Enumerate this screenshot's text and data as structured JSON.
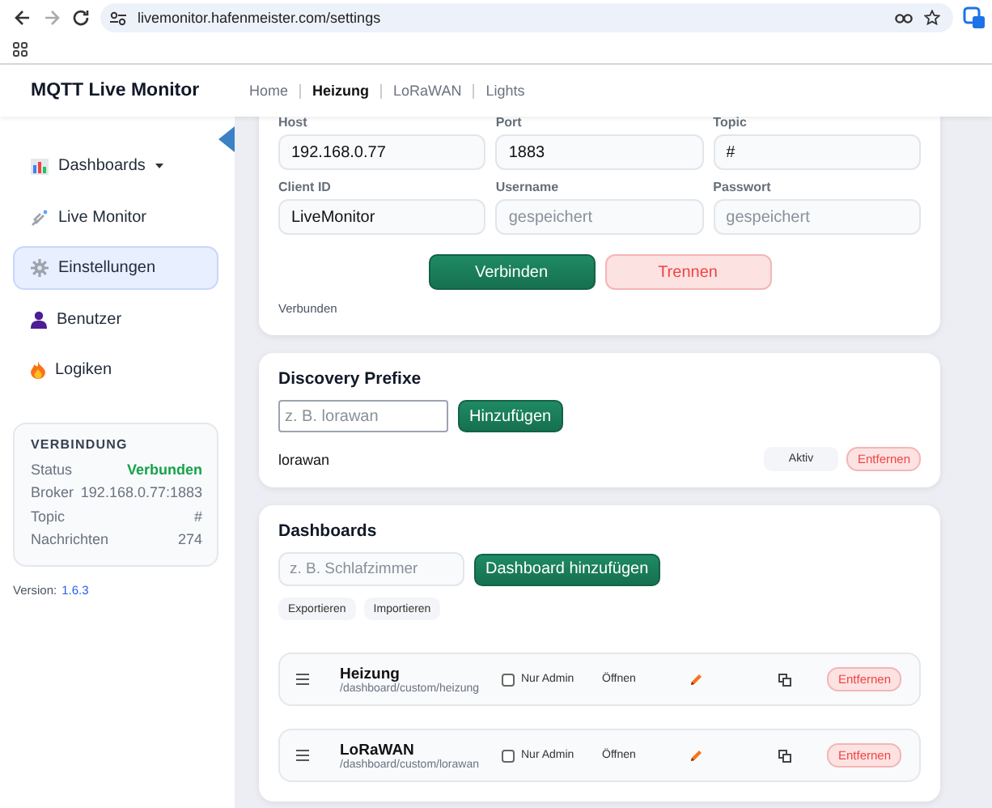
{
  "browser": {
    "url": "livemonitor.hafenmeister.com/settings"
  },
  "header": {
    "title": "MQTT Live Monitor",
    "nav": [
      {
        "label": "Home",
        "selected": false
      },
      {
        "label": "Heizung",
        "selected": true
      },
      {
        "label": "LoRaWAN",
        "selected": false
      },
      {
        "label": "Lights",
        "selected": false
      }
    ]
  },
  "sidebar": {
    "items": [
      {
        "label": "Dashboards",
        "dropdown": true,
        "selected": false
      },
      {
        "label": "Live Monitor",
        "dropdown": false,
        "selected": false
      },
      {
        "label": "Einstellungen",
        "dropdown": false,
        "selected": true
      },
      {
        "label": "Benutzer",
        "dropdown": false,
        "selected": false
      },
      {
        "label": "Logiken",
        "dropdown": false,
        "selected": false
      }
    ],
    "connection": {
      "title": "VERBINDUNG",
      "rows": [
        {
          "label": "Status",
          "value": "Verbunden",
          "kind": "status"
        },
        {
          "label": "Broker",
          "value": "192.168.0.77:1883",
          "kind": "plain"
        },
        {
          "label": "Topic",
          "value": "#",
          "kind": "plain"
        },
        {
          "label": "Nachrichten",
          "value": "274",
          "kind": "plain"
        }
      ]
    },
    "version_label": "Version:",
    "version": "1.6.3"
  },
  "mqtt": {
    "fields": [
      {
        "label": "Host",
        "value": "192.168.0.77"
      },
      {
        "label": "Port",
        "value": "1883"
      },
      {
        "label": "Topic",
        "value": "#"
      },
      {
        "label": "Client ID",
        "value": "LiveMonitor"
      },
      {
        "label": "Username",
        "placeholder": "gespeichert"
      },
      {
        "label": "Passwort",
        "placeholder": "gespeichert"
      }
    ],
    "connect_button": "Verbinden",
    "disconnect_button": "Trennen",
    "status": "Verbunden"
  },
  "discovery": {
    "title": "Discovery Prefixe",
    "input": {
      "placeholder": "z. B. lorawan"
    },
    "add_button": "Hinzufügen",
    "prefixes": [
      {
        "name": "lorawan",
        "status": "Aktiv",
        "remove_button": "Entfernen"
      }
    ]
  },
  "dashboards": {
    "title": "Dashboards",
    "input": {
      "placeholder": "z. B. Schlafzimmer"
    },
    "add_button": "Dashboard hinzufügen",
    "export_button": "Exportieren",
    "import_button": "Importieren",
    "rows": [
      {
        "name": "Heizung",
        "path": "/dashboard/custom/heizung",
        "admin_label": "Nur Admin",
        "admin_only": false,
        "open_link": "Öffnen",
        "remove_button": "Entfernen"
      },
      {
        "name": "LoRaWAN",
        "path": "/dashboard/custom/lorawan",
        "admin_label": "Nur Admin",
        "admin_only": false,
        "open_link": "Öffnen",
        "remove_button": "Entfernen"
      }
    ]
  }
}
